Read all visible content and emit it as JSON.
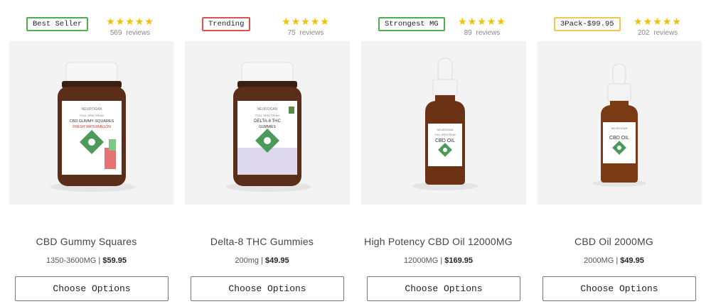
{
  "products": [
    {
      "badge": "Best Seller",
      "badge_color": "#4caf50",
      "stars": "★★★★★",
      "reviews": "569 reviews",
      "label_brand": "NEUROGAN",
      "label_line1": "FULL SPECTRUM",
      "label_line2": "CBD GUMMY SQUARES",
      "label_line3": "FRESH WATERMELON",
      "title": "CBD Gummy Squares",
      "variant": "1350-3600MG",
      "price": "$59.95",
      "button": "Choose Options"
    },
    {
      "badge": "Trending",
      "badge_color": "#d9534f",
      "stars": "★★★★★",
      "reviews": "75 reviews",
      "label_brand": "NEUROGAN",
      "label_line1": "FULL SPECTRUM",
      "label_line2": "DELTA-8 THC",
      "label_line3": "GUMMIES",
      "title": "Delta-8 THC Gummies",
      "variant": "200mg",
      "price": "$49.95",
      "button": "Choose Options"
    },
    {
      "badge": "Strongest MG",
      "badge_color": "#4caf50",
      "stars": "★★★★★",
      "reviews": "89 reviews",
      "label_brand": "NEUROGAN",
      "label_line1": "FULL SPECTRUM",
      "label_line2": "CBD OIL",
      "label_line3": "",
      "title": "High Potency CBD Oil 12000MG",
      "variant": "12000MG",
      "price": "$169.95",
      "button": "Choose Options"
    },
    {
      "badge": "3Pack-$99.95",
      "badge_color": "#f2c94c",
      "stars": "★★★★★",
      "reviews": "202 reviews",
      "label_brand": "NEUROGAN",
      "label_line1": "",
      "label_line2": "CBD OIL",
      "label_line3": "",
      "title": "CBD Oil 2000MG",
      "variant": "2000MG",
      "price": "$49.95",
      "button": "Choose Options"
    }
  ],
  "separator": " | "
}
